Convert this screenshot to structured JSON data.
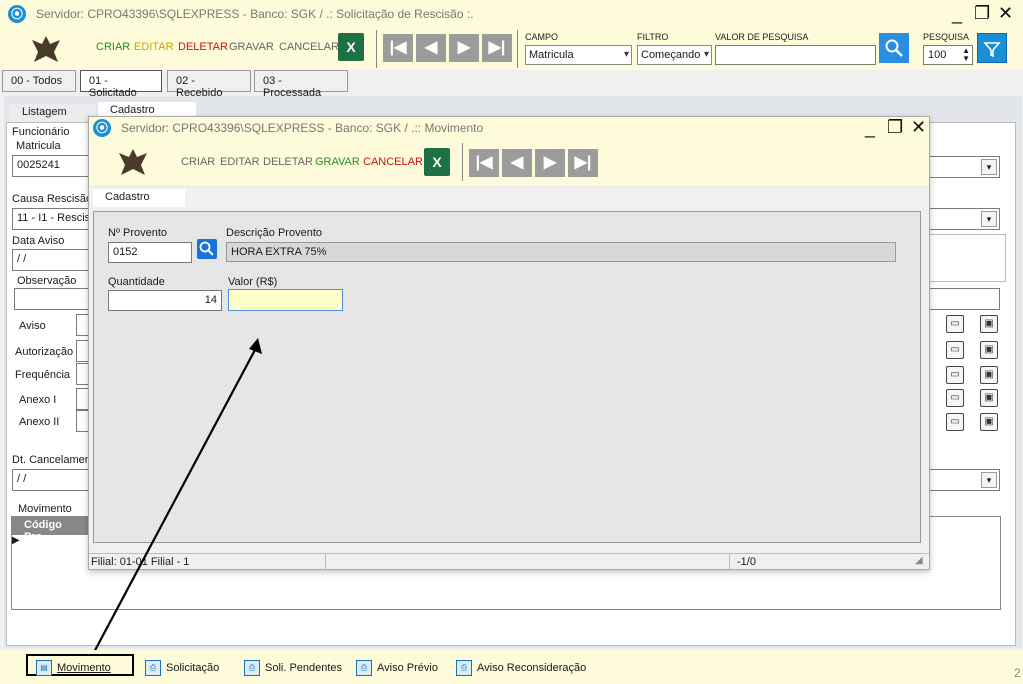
{
  "main_window": {
    "title": "Servidor: CPRO43396\\SQLEXPRESS - Banco: SGK / .: Solicitação de Rescisão :.",
    "controls": {
      "minimize": "_",
      "restore": "❐",
      "close": "✕"
    },
    "toolbar": {
      "criar": "CRIAR",
      "editar": "EDITAR",
      "deletar": "DELETAR",
      "gravar": "GRAVAR",
      "cancelar": "CANCELAR",
      "excel_glyph": "X",
      "nav": [
        "|◀",
        "◀",
        "▶",
        "▶|"
      ],
      "campo_label": "CAMPO",
      "campo_value": "Matricula",
      "filtro_label": "FILTRO",
      "filtro_value": "Começando",
      "valor_label": "VALOR DE PESQUISA",
      "valor_value": "",
      "pesquisa_label": "PESQUISA",
      "pesquisa_value": "100"
    },
    "status_tabs": [
      "00 - Todos",
      "01 - Solicitado",
      "02 - Recebido",
      "03 - Processada"
    ],
    "subtabs": [
      "Listagem",
      "Cadastro"
    ],
    "form": {
      "funcionario_group": "Funcionário",
      "matricula_label": "Matricula",
      "matricula_value": "0025241",
      "causa_label": "Causa Rescisão",
      "causa_value": "11 - I1 - Rescis",
      "data_aviso_label": "Data Aviso",
      "data_aviso_value": " / /",
      "observacao_label": "Observação",
      "docs": [
        "Aviso",
        "Autorização",
        "Frequência",
        "Anexo I",
        "Anexo II"
      ],
      "dt_cancel_label": "Dt. Cancelament",
      "dt_cancel_value": " / /",
      "movimento_group": "Movimento",
      "grid_col": "Código Pro"
    },
    "bottom_bar": [
      "Movimento",
      "Solicitação",
      "Soli. Pendentes",
      "Aviso Prévio",
      "Aviso Reconsideração"
    ],
    "corner_char": "2"
  },
  "modal": {
    "title": "Servidor: CPRO43396\\SQLEXPRESS - Banco: SGK / .:: Movimento",
    "toolbar": {
      "criar": "CRIAR",
      "editar": "EDITAR",
      "deletar": "DELETAR",
      "gravar": "GRAVAR",
      "cancelar": "CANCELAR"
    },
    "tab": "Cadastro",
    "fields": {
      "provento_label": "Nº Provento",
      "provento_value": "0152",
      "descricao_label": "Descrição Provento",
      "descricao_value": "HORA EXTRA 75%",
      "quantidade_label": "Quantidade",
      "quantidade_value": "14",
      "valor_label": "Valor (R$)",
      "valor_value": ""
    },
    "status_left": "Filial: 01-01 Filial - 1",
    "status_right": "-1/0"
  },
  "colors": {
    "titlebar_bg": "#fdfbd9",
    "accent_blue": "#1a8fd8",
    "excel_green": "#1e7145",
    "highlight_input": "#ffffc8"
  }
}
